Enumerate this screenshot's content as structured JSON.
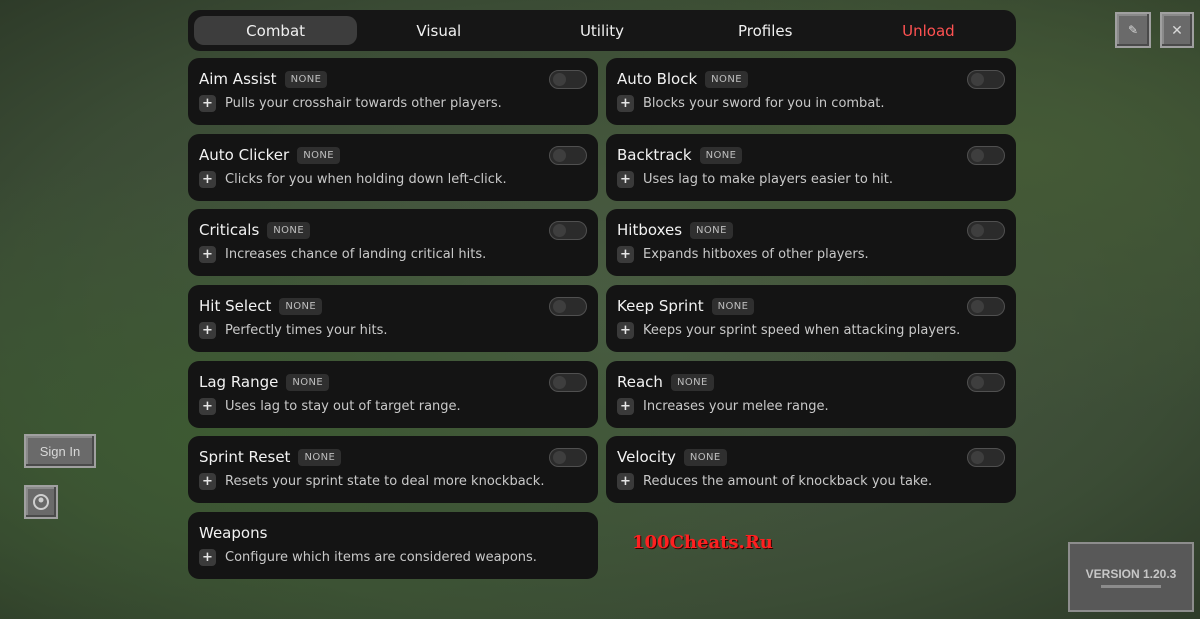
{
  "tabs": [
    {
      "label": "Combat",
      "active": true
    },
    {
      "label": "Visual"
    },
    {
      "label": "Utility"
    },
    {
      "label": "Profiles"
    },
    {
      "label": "Unload",
      "color": "#ff5252"
    }
  ],
  "badge_label": "NONE",
  "modules_left": [
    {
      "title": "Aim Assist",
      "desc": "Pulls your crosshair towards other players."
    },
    {
      "title": "Auto Clicker",
      "desc": "Clicks for you when holding down left-click."
    },
    {
      "title": "Criticals",
      "desc": "Increases chance of landing critical hits."
    },
    {
      "title": "Hit Select",
      "desc": "Perfectly times your hits."
    },
    {
      "title": "Lag Range",
      "desc": "Uses lag to stay out of target range."
    },
    {
      "title": "Sprint Reset",
      "desc": "Resets your sprint state to deal more knockback."
    },
    {
      "title": "Weapons",
      "desc": "Configure which items are considered weapons."
    }
  ],
  "modules_right": [
    {
      "title": "Auto Block",
      "desc": "Blocks your sword for you in combat."
    },
    {
      "title": "Backtrack",
      "desc": "Uses lag to make players easier to hit."
    },
    {
      "title": "Hitboxes",
      "desc": "Expands hitboxes of other players."
    },
    {
      "title": "Keep Sprint",
      "desc": "Keeps your sprint speed when attacking players."
    },
    {
      "title": "Reach",
      "desc": "Increases your melee range."
    },
    {
      "title": "Velocity",
      "desc": "Reduces the amount of knockback you take."
    }
  ],
  "background": {
    "sign_in_label": "Sign In",
    "close_label": "✕",
    "version_label": "VERSION 1.20.3",
    "watermark": "100Cheats.Ru"
  },
  "colors": {
    "panel": "#141414",
    "unload": "#ff5252",
    "watermark": "#ff2020"
  }
}
